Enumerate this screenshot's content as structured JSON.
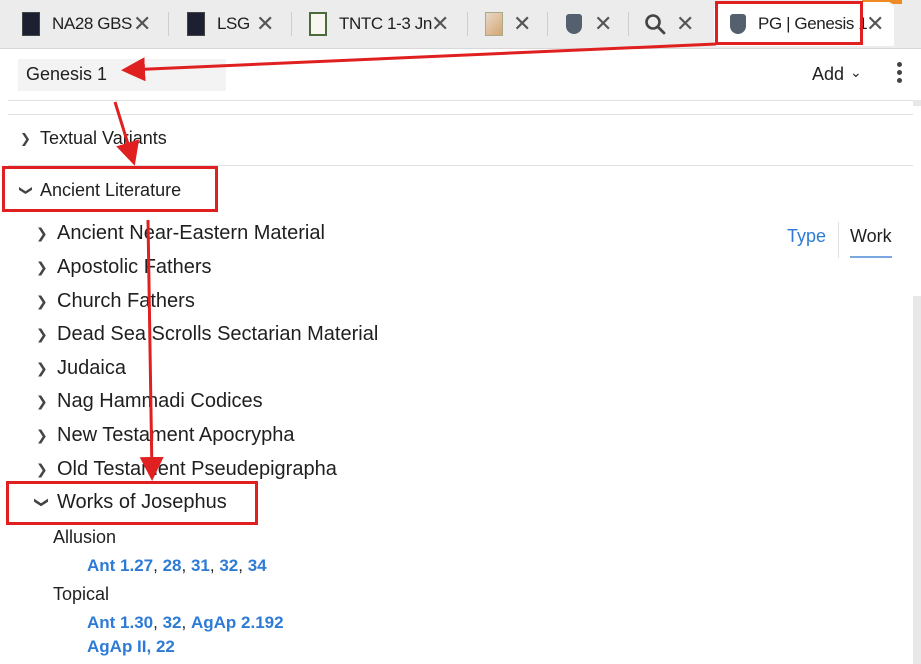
{
  "tabs": [
    {
      "label": "NA28 GBS",
      "icon": "book-cover-icon"
    },
    {
      "label": "LSG",
      "icon": "book-cover-icon"
    },
    {
      "label": "TNTC 1-3 Jn",
      "icon": "book-cover-icon"
    },
    {
      "label": "",
      "icon": "colorful-book-icon"
    },
    {
      "label": "",
      "icon": "shield-icon"
    },
    {
      "label": "",
      "icon": "search-icon"
    },
    {
      "label": "PG | Genesis 1",
      "icon": "shield-icon",
      "active": true
    }
  ],
  "close_glyph": "✕",
  "header": {
    "reference": "Genesis 1",
    "add_label": "Add"
  },
  "sections": {
    "textual_variants": "Textual Variants",
    "ancient_literature": "Ancient Literature"
  },
  "items": [
    "Ancient Near-Eastern Material",
    "Apostolic Fathers",
    "Church Fathers",
    "Dead Sea Scrolls Sectarian Material",
    "Judaica",
    "Nag Hammadi Codices",
    "New Testament Apocrypha",
    "Old Testament Pseudepigrapha",
    "Works of Josephus"
  ],
  "toggle": {
    "type": "Type",
    "work": "Work",
    "selected": "Work"
  },
  "josephus": {
    "allusion": {
      "label": "Allusion",
      "refs": [
        "Ant 1.27",
        "28",
        "31",
        "32",
        "34"
      ]
    },
    "topical": {
      "label": "Topical",
      "refs_line1": [
        "Ant 1.30",
        "32",
        "AgAp 2.192"
      ],
      "refs_line2": [
        "AgAp II, 22"
      ]
    }
  },
  "colors": {
    "accent": "#2e7bd6",
    "annotation": "#e02020",
    "tab_accent": "#f08a24"
  }
}
